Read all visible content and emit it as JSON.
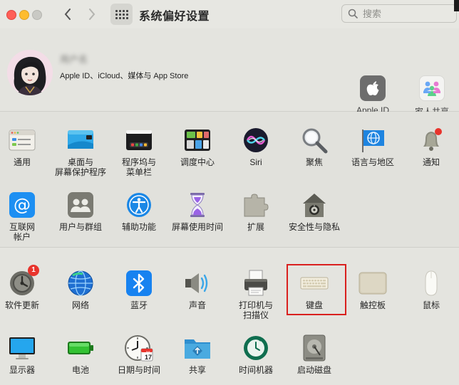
{
  "window": {
    "title": "系统偏好设置"
  },
  "search": {
    "placeholder": "搜索"
  },
  "account": {
    "name": "用户名",
    "subtitle": "Apple ID、iCloud、媒体与 App Store",
    "apple_id_label": "Apple ID",
    "family_label": "家人共享"
  },
  "prefs_row1": [
    {
      "label": "通用",
      "icon": "general-icon"
    },
    {
      "label": "桌面与\n屏幕保护程序",
      "icon": "desktop-screensaver-icon"
    },
    {
      "label": "程序坞与\n菜单栏",
      "icon": "dock-menubar-icon"
    },
    {
      "label": "调度中心",
      "icon": "mission-control-icon"
    },
    {
      "label": "Siri",
      "icon": "siri-icon"
    },
    {
      "label": "聚焦",
      "icon": "spotlight-icon"
    },
    {
      "label": "语言与地区",
      "icon": "language-region-icon"
    },
    {
      "label": "通知",
      "icon": "notifications-icon"
    }
  ],
  "prefs_row2": [
    {
      "label": "互联网\n帐户",
      "icon": "internet-accounts-icon"
    },
    {
      "label": "用户与群组",
      "icon": "users-groups-icon"
    },
    {
      "label": "辅助功能",
      "icon": "accessibility-icon"
    },
    {
      "label": "屏幕使用时间",
      "icon": "screen-time-icon"
    },
    {
      "label": "扩展",
      "icon": "extensions-icon"
    },
    {
      "label": "安全性与隐私",
      "icon": "security-privacy-icon"
    }
  ],
  "prefs_row3": [
    {
      "label": "软件更新",
      "icon": "software-update-icon",
      "badge": "1"
    },
    {
      "label": "网络",
      "icon": "network-icon"
    },
    {
      "label": "蓝牙",
      "icon": "bluetooth-icon"
    },
    {
      "label": "声音",
      "icon": "sound-icon"
    },
    {
      "label": "打印机与\n扫描仪",
      "icon": "printers-scanners-icon"
    },
    {
      "label": "键盘",
      "icon": "keyboard-icon",
      "highlighted": true
    },
    {
      "label": "触控板",
      "icon": "trackpad-icon"
    },
    {
      "label": "鼠标",
      "icon": "mouse-icon"
    }
  ],
  "prefs_row4": [
    {
      "label": "显示器",
      "icon": "displays-icon"
    },
    {
      "label": "电池",
      "icon": "battery-icon"
    },
    {
      "label": "日期与时间",
      "icon": "date-time-icon"
    },
    {
      "label": "共享",
      "icon": "sharing-icon"
    },
    {
      "label": "时间机器",
      "icon": "time-machine-icon"
    },
    {
      "label": "启动磁盘",
      "icon": "startup-disk-icon"
    }
  ],
  "date_icon": {
    "month": "JUL",
    "day": "17"
  },
  "colors": {
    "highlight": "#d9201e",
    "badge": "#e8342c"
  }
}
